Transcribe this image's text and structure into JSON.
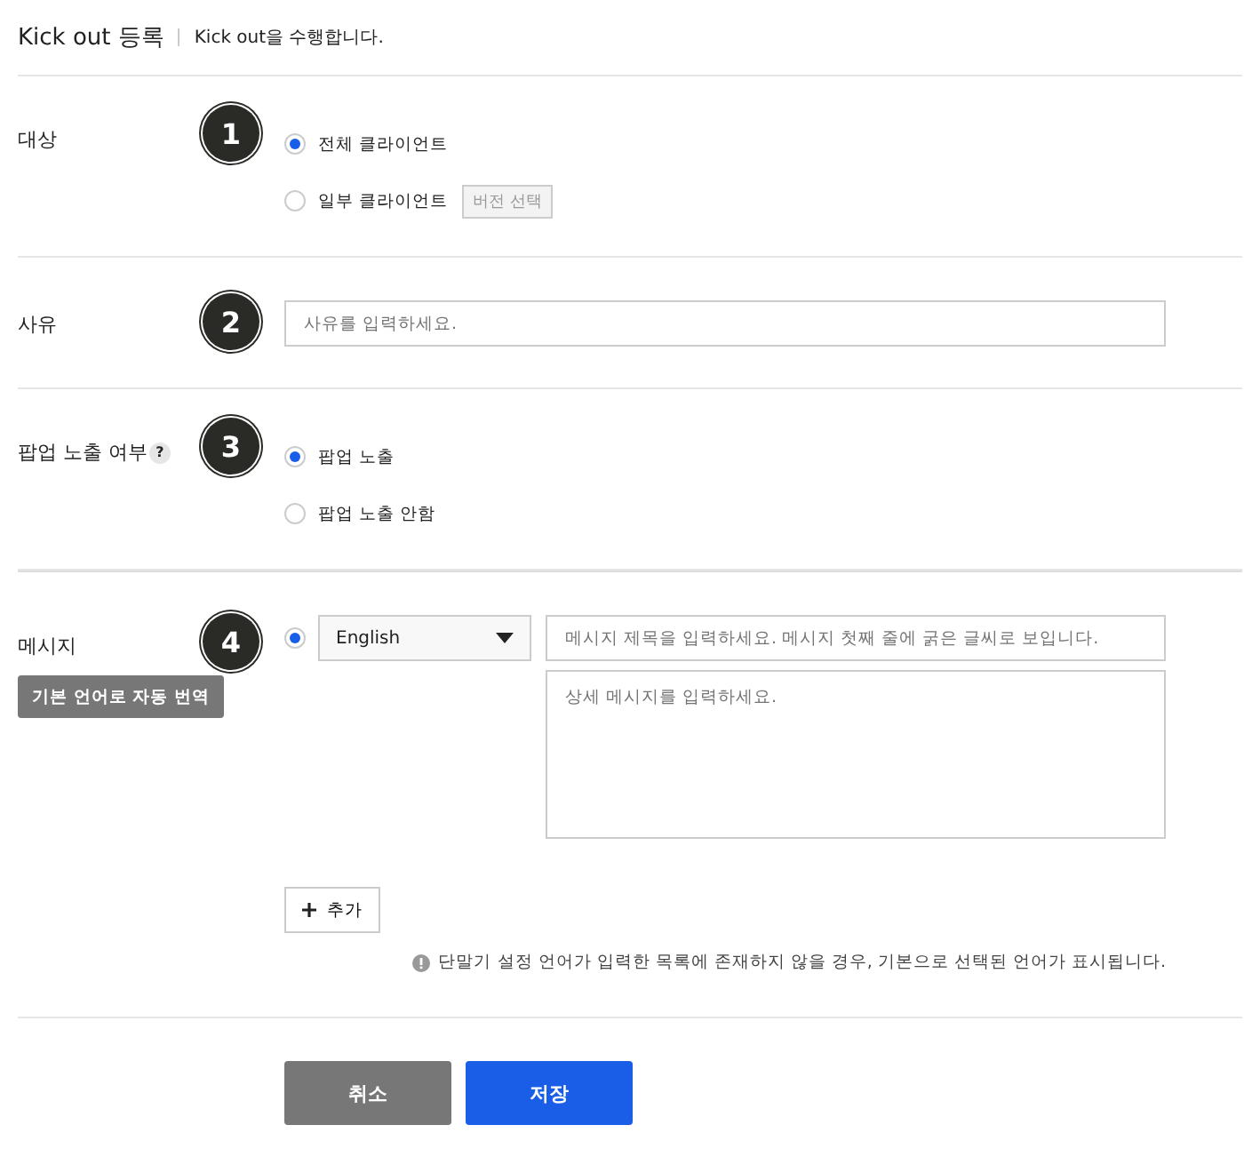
{
  "header": {
    "title": "Kick out 등록",
    "description": "Kick out을 수행합니다."
  },
  "sections": [
    {
      "kind": "radio",
      "label": "대상",
      "marker": "1",
      "options": [
        {
          "label": "전체 클라이언트",
          "selected": true
        },
        {
          "label": "일부 클라이언트",
          "selected": false,
          "button": "버전 선택"
        }
      ]
    },
    {
      "kind": "text",
      "label": "사유",
      "marker": "2",
      "placeholder": "사유를 입력하세요."
    },
    {
      "kind": "radio",
      "label": "팝업 노출 여부",
      "help": "?",
      "marker": "3",
      "options": [
        {
          "label": "팝업 노출",
          "selected": true
        },
        {
          "label": "팝업 노출 안함",
          "selected": false
        }
      ]
    },
    {
      "kind": "message",
      "label": "메시지",
      "marker": "4",
      "translate_button": "기본 언어로 자동 번역",
      "entries": [
        {
          "selected": true,
          "language": "English",
          "title_placeholder": "메시지 제목을 입력하세요. 메시지 첫째 줄에 굵은 글씨로 보입니다.",
          "body_placeholder": "상세 메시지를 입력하세요."
        }
      ],
      "add_button": "추가",
      "note": "단말기 설정 언어가 입력한 목록에 존재하지 않을 경우, 기본으로 선택된 언어가 표시됩니다."
    }
  ],
  "buttons": {
    "cancel": "취소",
    "save": "저장"
  }
}
